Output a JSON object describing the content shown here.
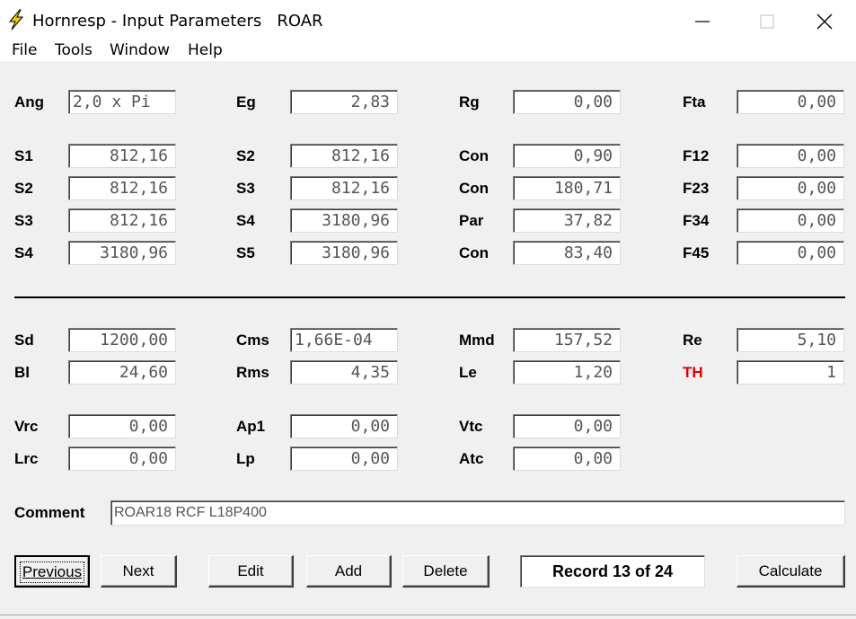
{
  "window": {
    "title": "Hornresp - Input Parameters   ROAR",
    "icon": "lightning-bolt-icon",
    "controls": [
      "minimize-icon",
      "maximize-icon",
      "close-icon"
    ]
  },
  "menu": [
    "File",
    "Tools",
    "Window",
    "Help"
  ],
  "row0": [
    {
      "label": "Ang",
      "value": "2,0 x Pi"
    },
    {
      "label": "Eg",
      "value": "2,83"
    },
    {
      "label": "Rg",
      "value": "0,00"
    },
    {
      "label": "Fta",
      "value": "0,00"
    }
  ],
  "rows_a": [
    [
      {
        "label": "S1",
        "value": "812,16"
      },
      {
        "label": "S2",
        "value": "812,16"
      },
      {
        "label": "Con",
        "value": "0,90"
      },
      {
        "label": "F12",
        "value": "0,00"
      }
    ],
    [
      {
        "label": "S2",
        "value": "812,16"
      },
      {
        "label": "S3",
        "value": "812,16"
      },
      {
        "label": "Con",
        "value": "180,71"
      },
      {
        "label": "F23",
        "value": "0,00"
      }
    ],
    [
      {
        "label": "S3",
        "value": "812,16"
      },
      {
        "label": "S4",
        "value": "3180,96"
      },
      {
        "label": "Par",
        "value": "37,82"
      },
      {
        "label": "F34",
        "value": "0,00"
      }
    ],
    [
      {
        "label": "S4",
        "value": "3180,96"
      },
      {
        "label": "S5",
        "value": "3180,96"
      },
      {
        "label": "Con",
        "value": "83,40"
      },
      {
        "label": "F45",
        "value": "0,00"
      }
    ]
  ],
  "rows_b": [
    [
      {
        "label": "Sd",
        "value": "1200,00"
      },
      {
        "label": "Cms",
        "value": "1,66E-04"
      },
      {
        "label": "Mmd",
        "value": "157,52"
      },
      {
        "label": "Re",
        "value": "5,10"
      }
    ],
    [
      {
        "label": "Bl",
        "value": "24,60"
      },
      {
        "label": "Rms",
        "value": "4,35"
      },
      {
        "label": "Le",
        "value": "1,20"
      },
      {
        "label": "TH",
        "value": "1"
      }
    ]
  ],
  "rows_c": [
    [
      {
        "label": "Vrc",
        "value": "0,00"
      },
      {
        "label": "Ap1",
        "value": "0,00"
      },
      {
        "label": "Vtc",
        "value": "0,00"
      }
    ],
    [
      {
        "label": "Lrc",
        "value": "0,00"
      },
      {
        "label": "Lp",
        "value": "0,00"
      },
      {
        "label": "Atc",
        "value": "0,00"
      }
    ]
  ],
  "comment": {
    "label": "Comment",
    "value": "ROAR18 RCF L18P400"
  },
  "buttons": {
    "previous": "Previous",
    "next": "Next",
    "edit": "Edit",
    "add": "Add",
    "delete": "Delete",
    "calculate": "Calculate"
  },
  "record": "Record 13 of 24",
  "colors": {
    "th_label": "#e00000",
    "bolt": "#f0d000"
  }
}
